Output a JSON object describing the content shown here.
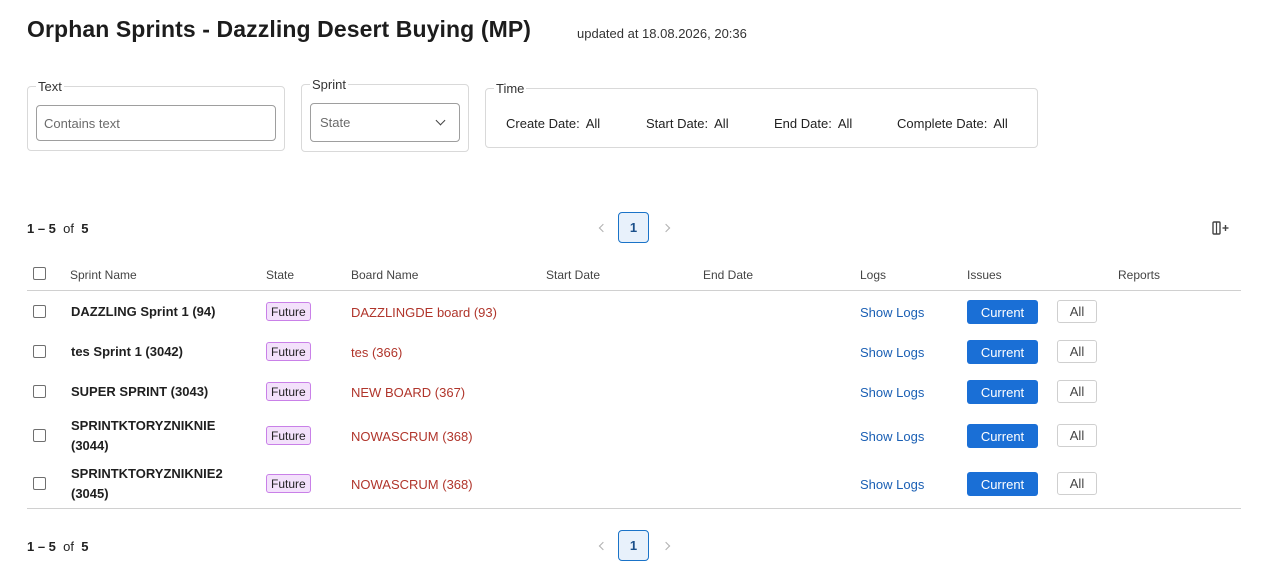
{
  "header": {
    "title": "Orphan Sprints - Dazzling Desert Buying (MP)",
    "updated": "updated at 18.08.2026, 20:36"
  },
  "filters": {
    "text": {
      "legend": "Text",
      "placeholder": "Contains text",
      "value": ""
    },
    "sprint": {
      "legend": "Sprint",
      "placeholder": "State",
      "icon": "chevron-down-icon"
    },
    "time": {
      "legend": "Time",
      "items": [
        {
          "label": "Create Date:",
          "value": "All"
        },
        {
          "label": "Start Date:",
          "value": "All"
        },
        {
          "label": "End Date:",
          "value": "All"
        },
        {
          "label": "Complete Date:",
          "value": "All"
        }
      ]
    }
  },
  "pagination": {
    "range": "1 – 5",
    "of": "of",
    "total": "5",
    "page": "1",
    "prev_icon": "chevron-left-icon",
    "next_icon": "chevron-right-icon"
  },
  "toolbar": {
    "columns_icon": "add-column-icon"
  },
  "table": {
    "columns": [
      "Sprint Name",
      "State",
      "Board Name",
      "Start Date",
      "End Date",
      "Logs",
      "Issues",
      "Reports"
    ],
    "rows": [
      {
        "name": [
          "DAZZLING Sprint 1 (94)"
        ],
        "state": "Future",
        "board": "DAZZLINGDE board (93)",
        "start": "",
        "end": "",
        "logs": "Show Logs",
        "current": "Current",
        "all": "All"
      },
      {
        "name": [
          "tes Sprint 1 (3042)"
        ],
        "state": "Future",
        "board": "tes (366)",
        "start": "",
        "end": "",
        "logs": "Show Logs",
        "current": "Current",
        "all": "All"
      },
      {
        "name": [
          "SUPER SPRINT (3043)"
        ],
        "state": "Future",
        "board": "NEW BOARD (367)",
        "start": "",
        "end": "",
        "logs": "Show Logs",
        "current": "Current",
        "all": "All"
      },
      {
        "name": [
          "SPRINTKTORYZNIKNIE",
          "(3044)"
        ],
        "state": "Future",
        "board": "NOWASCRUM (368)",
        "start": "",
        "end": "",
        "logs": "Show Logs",
        "current": "Current",
        "all": "All"
      },
      {
        "name": [
          "SPRINTKTORYZNIKNIE2",
          "(3045)"
        ],
        "state": "Future",
        "board": "NOWASCRUM (368)",
        "start": "",
        "end": "",
        "logs": "Show Logs",
        "current": "Current",
        "all": "All"
      }
    ]
  },
  "colors": {
    "accent": "#1a6fd6",
    "link": "#1a5fb4",
    "board_link": "#b0352b",
    "badge_bg": "#f3e1fb",
    "badge_border": "#c980e8"
  }
}
